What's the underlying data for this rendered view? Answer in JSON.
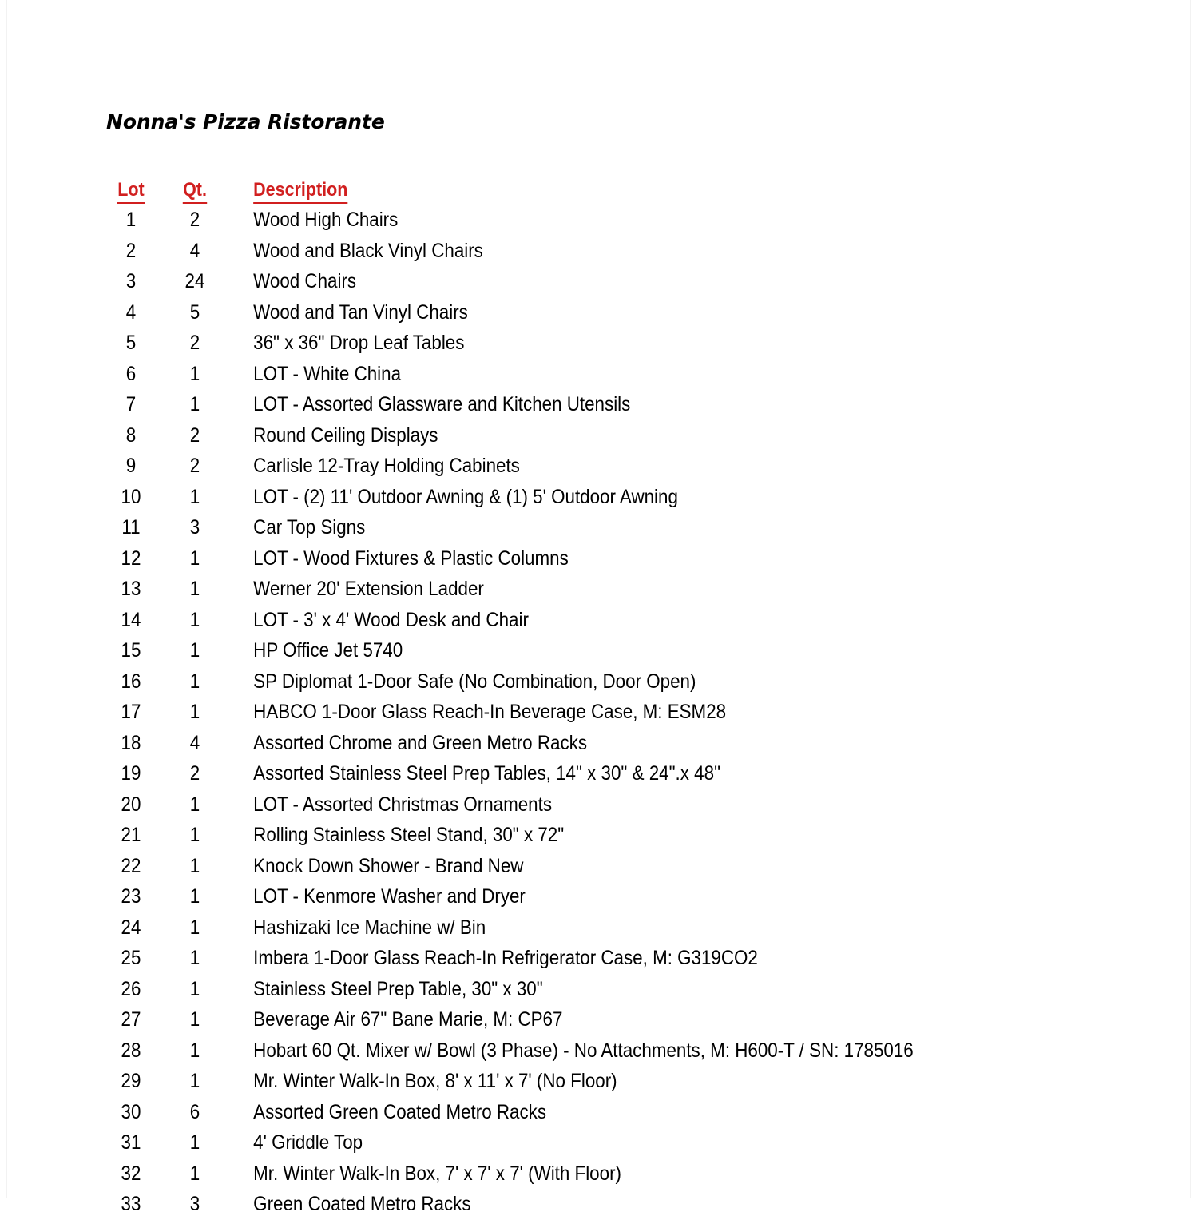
{
  "document": {
    "title": "Nonna's Pizza Ristorante",
    "accent_color": "#D11F1F",
    "text_color": "#000000",
    "background_color": "#FFFFFF"
  },
  "table": {
    "headers": {
      "lot": "Lot",
      "qty": "Qt.",
      "description": "Description"
    },
    "rows": [
      {
        "lot": "1",
        "qty": "2",
        "description": "Wood High Chairs"
      },
      {
        "lot": "2",
        "qty": "4",
        "description": "Wood and Black Vinyl Chairs"
      },
      {
        "lot": "3",
        "qty": "24",
        "description": "Wood Chairs"
      },
      {
        "lot": "4",
        "qty": "5",
        "description": "Wood and Tan Vinyl Chairs"
      },
      {
        "lot": "5",
        "qty": "2",
        "description": "36\" x 36\" Drop Leaf Tables"
      },
      {
        "lot": "6",
        "qty": "1",
        "description": "LOT - White China"
      },
      {
        "lot": "7",
        "qty": "1",
        "description": "LOT - Assorted Glassware and Kitchen Utensils"
      },
      {
        "lot": "8",
        "qty": "2",
        "description": "Round Ceiling Displays"
      },
      {
        "lot": "9",
        "qty": "2",
        "description": "Carlisle 12-Tray Holding Cabinets"
      },
      {
        "lot": "10",
        "qty": "1",
        "description": "LOT - (2) 11' Outdoor Awning & (1) 5' Outdoor Awning"
      },
      {
        "lot": "11",
        "qty": "3",
        "description": "Car Top Signs"
      },
      {
        "lot": "12",
        "qty": "1",
        "description": "LOT - Wood Fixtures & Plastic Columns"
      },
      {
        "lot": "13",
        "qty": "1",
        "description": "Werner 20' Extension Ladder"
      },
      {
        "lot": "14",
        "qty": "1",
        "description": "LOT - 3' x 4' Wood Desk and Chair"
      },
      {
        "lot": "15",
        "qty": "1",
        "description": "HP Office Jet 5740"
      },
      {
        "lot": "16",
        "qty": "1",
        "description": "SP Diplomat 1-Door Safe (No Combination, Door Open)"
      },
      {
        "lot": "17",
        "qty": "1",
        "description": "HABCO 1-Door Glass Reach-In Beverage Case, M: ESM28"
      },
      {
        "lot": "18",
        "qty": "4",
        "description": "Assorted Chrome and Green Metro Racks"
      },
      {
        "lot": "19",
        "qty": "2",
        "description": "Assorted Stainless Steel Prep Tables, 14\" x 30\" & 24\".x 48\""
      },
      {
        "lot": "20",
        "qty": "1",
        "description": "LOT - Assorted Christmas Ornaments"
      },
      {
        "lot": "21",
        "qty": "1",
        "description": "Rolling Stainless Steel Stand, 30\" x 72\""
      },
      {
        "lot": "22",
        "qty": "1",
        "description": "Knock Down Shower - Brand New"
      },
      {
        "lot": "23",
        "qty": "1",
        "description": "LOT - Kenmore Washer and Dryer"
      },
      {
        "lot": "24",
        "qty": "1",
        "description": "Hashizaki Ice Machine w/ Bin"
      },
      {
        "lot": "25",
        "qty": "1",
        "description": "Imbera 1-Door Glass Reach-In Refrigerator Case, M: G319CO2"
      },
      {
        "lot": "26",
        "qty": "1",
        "description": "Stainless Steel Prep Table, 30\" x 30\""
      },
      {
        "lot": "27",
        "qty": "1",
        "description": "Beverage Air 67\" Bane Marie, M: CP67"
      },
      {
        "lot": "28",
        "qty": "1",
        "description": "Hobart 60 Qt. Mixer w/ Bowl (3 Phase) - No Attachments, M: H600-T / SN: 1785016"
      },
      {
        "lot": "29",
        "qty": "1",
        "description": "Mr. Winter Walk-In Box, 8' x 11' x 7' (No Floor)"
      },
      {
        "lot": "30",
        "qty": "6",
        "description": "Assorted Green Coated Metro Racks"
      },
      {
        "lot": "31",
        "qty": "1",
        "description": "4' Griddle Top"
      },
      {
        "lot": "32",
        "qty": "1",
        "description": "Mr. Winter Walk-In Box, 7' x 7' x 7' (With Floor)"
      },
      {
        "lot": "33",
        "qty": "3",
        "description": "Green Coated Metro Racks"
      }
    ]
  }
}
